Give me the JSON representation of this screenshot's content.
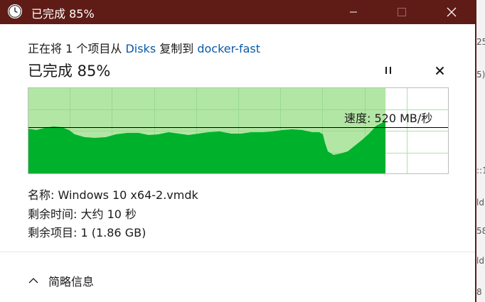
{
  "window": {
    "title": "已完成 85%",
    "controls": [
      "minimize-icon",
      "maximize-icon",
      "close-icon"
    ]
  },
  "copy": {
    "prefix": "正在将 1 个项目从",
    "source": "Disks",
    "middle": "复制到",
    "destination": "docker-fast"
  },
  "progress": {
    "title": "已完成 85%",
    "percent": 85,
    "speed_label": "速度: 520 MB/秒"
  },
  "details": {
    "name": "名称: Windows 10 x64-2.vmdk",
    "time_remaining": "剩余时间: 大约 10 秒",
    "items_remaining": "剩余项目: 1 (1.86 GB)"
  },
  "footer": {
    "less_info": "简略信息"
  },
  "background_window": {
    "fragments": [
      "25",
      "5)",
      "::1",
      "ld",
      "58",
      "ld",
      "8"
    ]
  },
  "colors": {
    "titlebar": "#5f1c17",
    "graph_fill": "#00b12c",
    "graph_progress": "#b2e6a4",
    "link": "#0a5aa8"
  }
}
